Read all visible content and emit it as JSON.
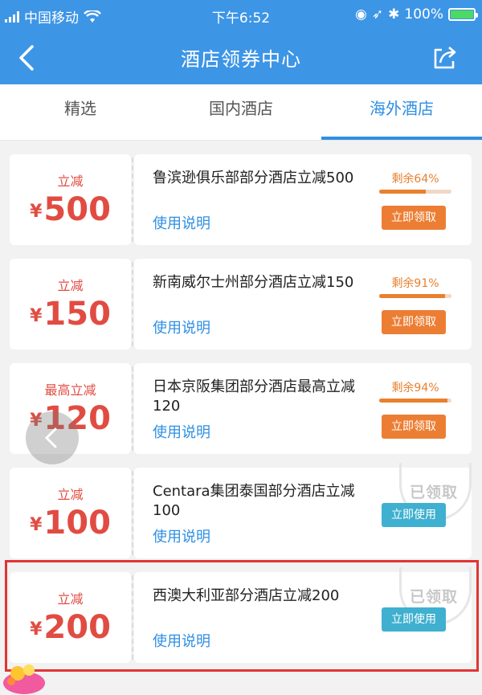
{
  "statusbar": {
    "carrier": "中国移动",
    "time": "下午6:52",
    "battery": "100%"
  },
  "navbar": {
    "title": "酒店领券中心"
  },
  "tabs": [
    {
      "label": "精选"
    },
    {
      "label": "国内酒店"
    },
    {
      "label": "海外酒店",
      "active": true
    }
  ],
  "coupons": [
    {
      "tag": "立减",
      "currency": "¥",
      "amount": "500",
      "name": "鲁滨逊俱乐部部分酒店立减500",
      "desc": "使用说明",
      "remain": "剩余64%",
      "remain_percent": 64,
      "button": "立即领取"
    },
    {
      "tag": "立减",
      "currency": "¥",
      "amount": "150",
      "name": "新南威尔士州部分酒店立减150",
      "desc": "使用说明",
      "remain": "剩余91%",
      "remain_percent": 91,
      "button": "立即领取"
    },
    {
      "tag": "最高立减",
      "currency": "¥",
      "amount": "120",
      "name": "日本京阪集团部分酒店最高立减120",
      "desc": "使用说明",
      "remain": "剩余94%",
      "remain_percent": 94,
      "button": "立即领取"
    },
    {
      "tag": "立减",
      "currency": "¥",
      "amount": "100",
      "name": "Centara集团泰国部分酒店立减100",
      "desc": "使用说明",
      "stamp": "已领取",
      "button": "立即使用"
    },
    {
      "tag": "立减",
      "currency": "¥",
      "amount": "200",
      "name": "西澳大利亚部分酒店立减200",
      "desc": "使用说明",
      "stamp": "已领取",
      "button": "立即使用"
    }
  ],
  "colors": {
    "primary": "#3d95e6",
    "price": "#e14c42",
    "claim": "#ec7e34",
    "use": "#3fb0cf",
    "highlight": "#e23434"
  }
}
